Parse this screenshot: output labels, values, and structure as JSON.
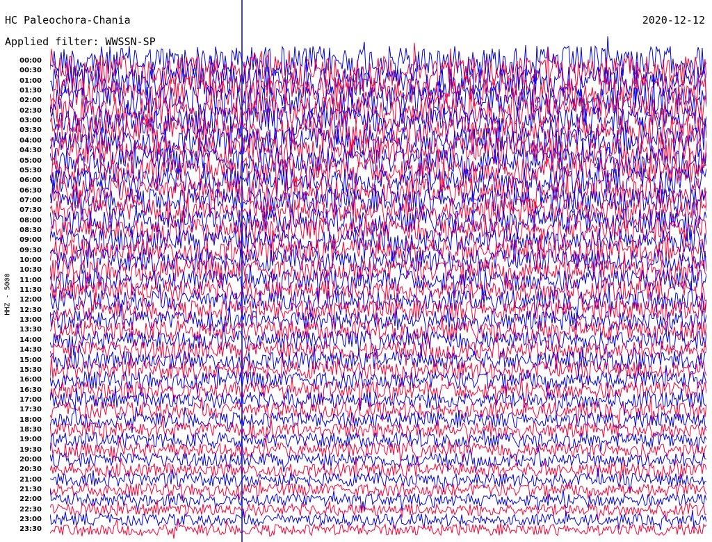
{
  "header": {
    "station": "HC Paleochora-Chania",
    "date": "2020-12-12",
    "filter": "Applied filter: WWSSN-SP"
  },
  "y_axis_label": "HHZ - 5000",
  "colors": {
    "odd_trace": "#ff0033",
    "even_trace": "#0000ee",
    "background": "#ffffff"
  },
  "chart_data": {
    "type": "line",
    "description_kind": "helicorder",
    "row_labels": [
      "00:00",
      "00:30",
      "01:00",
      "01:30",
      "02:00",
      "02:30",
      "03:00",
      "03:30",
      "04:00",
      "04:30",
      "05:00",
      "05:30",
      "06:00",
      "06:30",
      "07:00",
      "07:30",
      "08:00",
      "08:30",
      "09:00",
      "09:30",
      "10:00",
      "10:30",
      "11:00",
      "11:30",
      "12:00",
      "12:30",
      "13:00",
      "13:30",
      "14:00",
      "14:30",
      "15:00",
      "15:30",
      "16:00",
      "16:30",
      "17:00",
      "17:30",
      "18:00",
      "18:30",
      "19:00",
      "19:30",
      "20:00",
      "20:30",
      "21:00",
      "21:30",
      "22:00",
      "22:30",
      "23:00",
      "23:30"
    ],
    "minutes_per_row": 30,
    "grid": false
  }
}
